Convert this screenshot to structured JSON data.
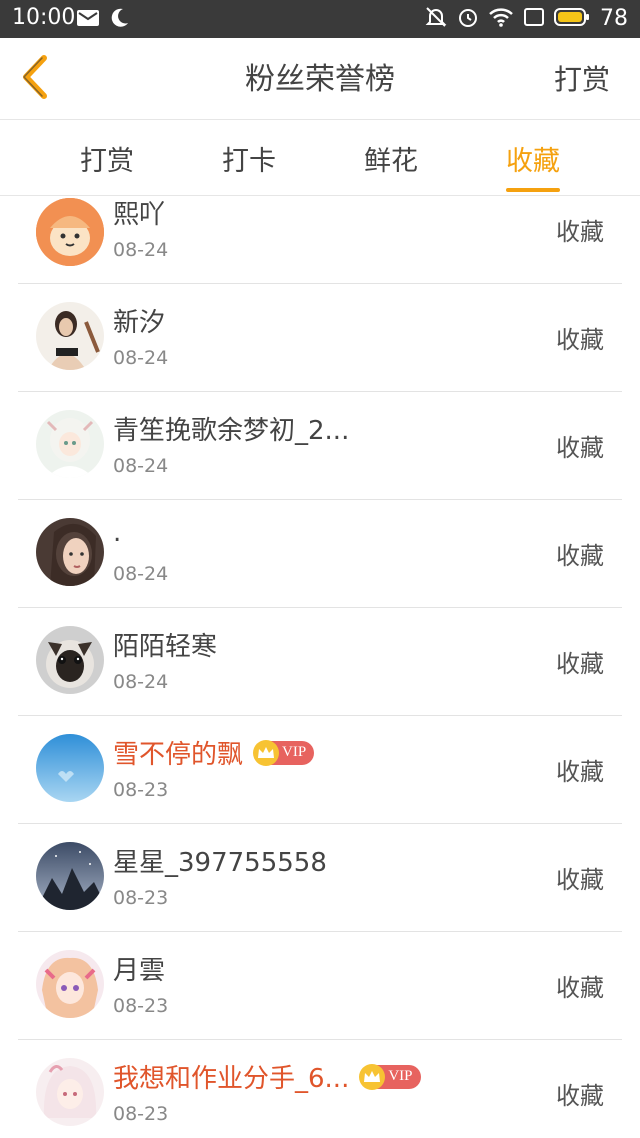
{
  "status_bar": {
    "time": "10:00",
    "battery": "78",
    "icons": [
      "mail-icon",
      "moon-icon",
      "mute-icon",
      "alarm-icon",
      "wifi-icon",
      "screen-icon",
      "battery-icon"
    ]
  },
  "header": {
    "title": "粉丝荣誉榜",
    "right_action": "打赏"
  },
  "tabs": [
    {
      "label": "打赏",
      "active": false
    },
    {
      "label": "打卡",
      "active": false
    },
    {
      "label": "鲜花",
      "active": false
    },
    {
      "label": "收藏",
      "active": true
    }
  ],
  "accent_color": "#f5a10f",
  "vip_name_color": "#e0552b",
  "vip_label": "VIP",
  "list": [
    {
      "name": "熙吖",
      "date": "08-24",
      "action": "收藏",
      "vip": false,
      "avatar": "orange-cartoon-avatar"
    },
    {
      "name": "新汐",
      "date": "08-24",
      "action": "收藏",
      "vip": false,
      "avatar": "woman-sketch-avatar"
    },
    {
      "name": "青笙挽歌余梦初_2...",
      "date": "08-24",
      "action": "收藏",
      "vip": false,
      "avatar": "anime-girl-avatar"
    },
    {
      "name": ".",
      "date": "08-24",
      "action": "收藏",
      "vip": false,
      "avatar": "girl-photo-avatar"
    },
    {
      "name": "陌陌轻寒",
      "date": "08-24",
      "action": "收藏",
      "vip": false,
      "avatar": "cat-avatar"
    },
    {
      "name": "雪不停的飘",
      "date": "08-23",
      "action": "收藏",
      "vip": true,
      "avatar": "blue-sky-avatar"
    },
    {
      "name": "星星_397755558",
      "date": "08-23",
      "action": "收藏",
      "vip": false,
      "avatar": "mountain-avatar"
    },
    {
      "name": "月雲",
      "date": "08-23",
      "action": "收藏",
      "vip": false,
      "avatar": "anime-pink-avatar"
    },
    {
      "name": "我想和作业分手_6...",
      "date": "08-23",
      "action": "收藏",
      "vip": true,
      "avatar": "anime-white-avatar"
    }
  ]
}
